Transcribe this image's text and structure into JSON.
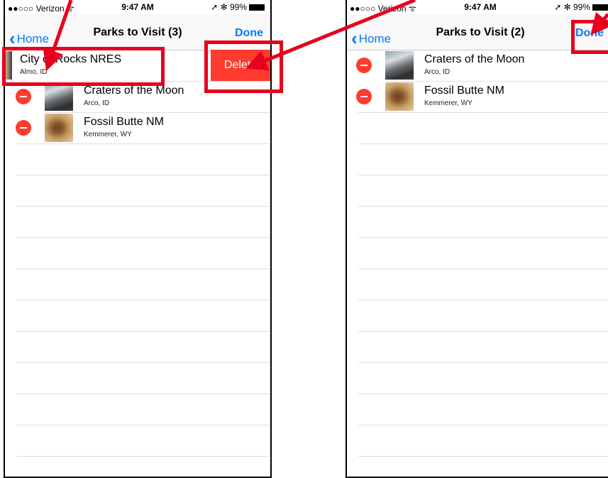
{
  "left_screen": {
    "status": {
      "carrier": "●●○○○ Verizon ᯤ",
      "time": "9:47 AM",
      "battery": "➚ ✻ 99%"
    },
    "nav": {
      "back_label": "Home",
      "title": "Parks to Visit (3)",
      "done_label": "Done"
    },
    "swiped_row": {
      "title": "City of Rocks NRES",
      "subtitle": "Almo, ID",
      "delete_label": "Delete"
    },
    "rows": [
      {
        "title": "Craters of the Moon",
        "subtitle": "Arco, ID",
        "icon": "craters-thumbnail"
      },
      {
        "title": "Fossil Butte NM",
        "subtitle": "Kemmerer, WY",
        "icon": "fossil-thumbnail"
      }
    ]
  },
  "right_screen": {
    "status": {
      "carrier": "●●○○○ Verizon ᯤ",
      "time": "9:47 AM",
      "battery": "➚ ✻ 99%"
    },
    "nav": {
      "back_label": "Home",
      "title": "Parks to Visit (2)",
      "done_label": "Done"
    },
    "rows": [
      {
        "title": "Craters of the Moon",
        "subtitle": "Arco, ID",
        "icon": "craters-thumbnail"
      },
      {
        "title": "Fossil Butte NM",
        "subtitle": "Kemmerer, WY",
        "icon": "fossil-thumbnail"
      }
    ]
  },
  "colors": {
    "ios_blue": "#0a7aff",
    "delete_red": "#ff3b30",
    "highlight_red": "#e8001c"
  }
}
